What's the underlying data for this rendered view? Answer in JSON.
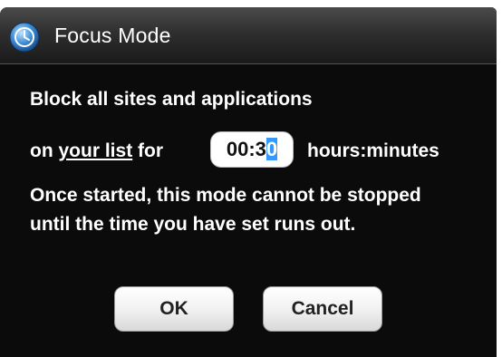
{
  "dialog": {
    "title": "Focus Mode",
    "line1": "Block all sites and applications",
    "line2_prefix": "on",
    "link_text": "your list",
    "line2_for": "for",
    "time_value_before": "00:3",
    "time_value_selected": "0",
    "units_label": "hours:minutes",
    "warning": "Once started, this mode cannot be stopped until the time you have set runs out.",
    "ok_label": "OK",
    "cancel_label": "Cancel"
  },
  "icons": {
    "app_icon": "clock-icon"
  },
  "colors": {
    "background": "#0b0b0b",
    "text": "#ffffff",
    "selection": "#3399ff"
  }
}
